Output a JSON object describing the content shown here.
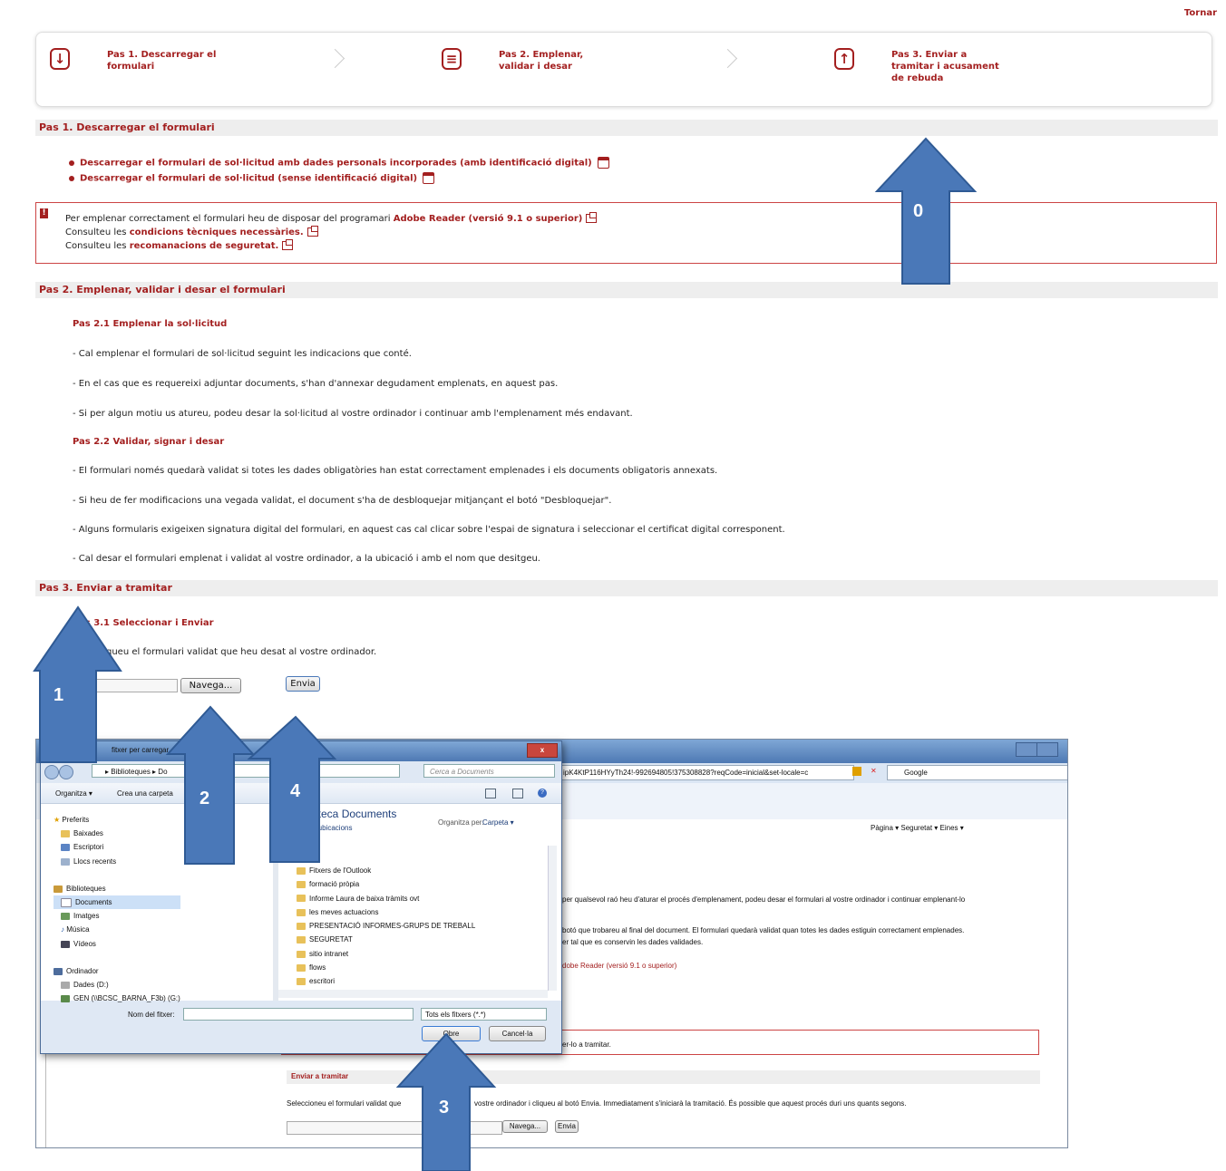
{
  "top_link": "Tornar",
  "steps": [
    {
      "icon": "download-icon",
      "glyph": "↓",
      "label": "Pas 1. Descarregar el formulari"
    },
    {
      "icon": "form-icon",
      "glyph": "≡",
      "label": "Pas 2. Emplenar, validar i desar"
    },
    {
      "icon": "upload-icon",
      "glyph": "↑",
      "label": "Pas 3. Enviar a tramitar i acusament de rebuda"
    }
  ],
  "sec1": {
    "title": "Pas 1. Descarregar el formulari",
    "links": [
      "Descarregar el formulari de sol·licitud amb dades personals incorporades (amb identificació digital)",
      "Descarregar el formulari de sol·licitud (sense identificació digital)"
    ]
  },
  "warning": {
    "l1_pre": "Per emplenar correctament el formulari heu de disposar del programari ",
    "l1_link": "Adobe Reader (versió 9.1 o superior)",
    "l2_pre": "Consulteu les ",
    "l2_link": "condicions tècniques necessàries.",
    "l3_pre": "Consulteu les ",
    "l3_link": "recomanacions de seguretat."
  },
  "sec2": {
    "title": "Pas 2. Emplenar, validar i desar el formulari",
    "sub1": "Pas 2.1 Emplenar la sol·licitud",
    "p1": "- Cal emplenar el formulari de sol·licitud seguint les indicacions que conté.",
    "p2": "- En el cas que es requereixi adjuntar documents, s'han d'annexar degudament emplenats, en aquest pas.",
    "p3": "- Si per algun motiu us atureu, podeu desar la sol·licitud al vostre ordinador i continuar amb l'emplenament més endavant.",
    "sub2": "Pas 2.2 Validar, signar i desar",
    "p4": "- El formulari només quedarà validat si totes les dades obligatòries han estat correctament emplenades i els documents obligatoris annexats.",
    "p5": "- Si heu de fer modificacions una vegada validat, el document s'ha de desbloquejar mitjançant el botó \"Desbloquejar\".",
    "p6": "- Alguns formularis exigeixen signatura digital del formulari, en aquest cas cal clicar sobre l'espai de signatura i seleccionar el certificat digital corresponent.",
    "p7": "- Cal desar el formulari emplenat i validat al vostre ordinador, a la ubicació i amb el nom que desitgeu."
  },
  "sec3": {
    "title": "Pas 3. Enviar a tramitar",
    "sub1": "Pas 3.1 Seleccionar i Enviar",
    "p1": "queu el formulari validat que heu desat al vostre ordinador.",
    "browse": "Navega...",
    "send": "Envia"
  },
  "arrows": [
    "0",
    "1",
    "2",
    "3",
    "4"
  ],
  "dialog": {
    "title": "fitxer per carregar",
    "path": "▸ Biblioteques ▸ Do",
    "search": "Cerca a Documents",
    "organize": "Organitza ▾",
    "new_folder": "Crea una carpeta",
    "library_title": "oteca Documents",
    "library_sub": "4 ubicacions",
    "arrange_label": "Organitza per:",
    "arrange_value": "Carpeta ▾",
    "nav": [
      "Preferits",
      "Baixades",
      "Escriptori",
      "Llocs recents",
      "Biblioteques",
      "Documents",
      "Imatges",
      "Música",
      "Vídeos",
      "Ordinador",
      "Dades (D:)",
      "GEN (\\\\BCSC_BARNA_F3b) (G:)"
    ],
    "files": [
      "Fitxers de l'Outlook",
      "formació pròpia",
      "Informe Laura de baixa tràmits ovt",
      "les meves actuacions",
      "PRESENTACIÓ INFORMES-GRUPS DE TREBALL",
      "SEGURETAT",
      "sitio intranet",
      "flows",
      "escritori"
    ],
    "filename_label": "Nom del fitxer:",
    "filter": "Tots els fitxers (*.*)",
    "open": "Obre",
    "cancel": "Cancel·la"
  },
  "bg": {
    "url": "ipK4KtP116HYyTh24!-992694805!375308828?reqCode=inicial&set-locale=c",
    "google": "Google",
    "toolbar": "Pàgina ▾  Seguretat ▾  Eines ▾",
    "t1": "per qualsevol raó heu d'aturar el procés d'emplenament, podeu desar el formulari al vostre ordinador i continuar emplenant-lo",
    "t2": "botó que trobareu al final del document. El formulari quedarà validat quan totes les dades estiguin correctament emplenades.",
    "t3": "er tal que es conservin les dades validades.",
    "t4": "dobe Reader (versió 9.1 o superior)",
    "t5": "er-lo a tramitar.",
    "send_title": "Enviar a tramitar",
    "send_text_a": "Seleccioneu el formulari validat que",
    "send_text_b": "vostre ordinador i cliqueu al botó Envia. Immediatament s'iniciarà la tramitació. És possible que aquest procés duri uns quants segons.",
    "browse": "Navega...",
    "send": "Envia"
  }
}
